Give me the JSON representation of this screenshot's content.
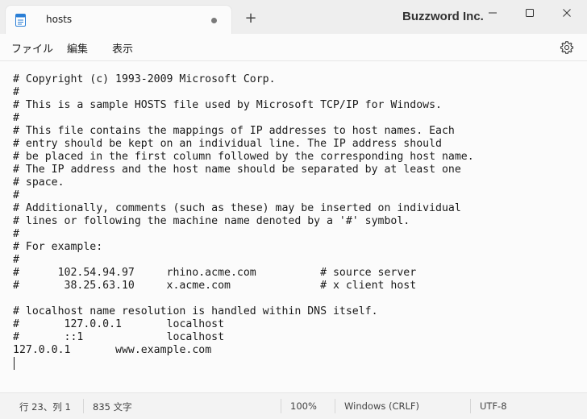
{
  "tab": {
    "title": "hosts",
    "new_tab_symbol": "+"
  },
  "brand": "Buzzword Inc.",
  "menu": {
    "file": "ファイル",
    "edit": "編集",
    "view": "表示"
  },
  "editor": {
    "content": "# Copyright (c) 1993-2009 Microsoft Corp.\n#\n# This is a sample HOSTS file used by Microsoft TCP/IP for Windows.\n#\n# This file contains the mappings of IP addresses to host names. Each\n# entry should be kept on an individual line. The IP address should\n# be placed in the first column followed by the corresponding host name.\n# The IP address and the host name should be separated by at least one\n# space.\n#\n# Additionally, comments (such as these) may be inserted on individual\n# lines or following the machine name denoted by a '#' symbol.\n#\n# For example:\n#\n#      102.54.94.97     rhino.acme.com          # source server\n#       38.25.63.10     x.acme.com              # x client host\n\n# localhost name resolution is handled within DNS itself.\n#\t127.0.0.1       localhost\n#\t::1             localhost\n127.0.0.1\twww.example.com\n"
  },
  "status": {
    "position": "行 23、列 1",
    "char_count": "835 文字",
    "zoom": "100%",
    "line_ending": "Windows (CRLF)",
    "encoding": "UTF-8"
  },
  "icons": {
    "doc": "document-icon",
    "dot": "unsaved-dot",
    "settings": "gear-icon",
    "minimize": "minimize-icon",
    "maximize": "maximize-icon",
    "close": "close-icon"
  }
}
